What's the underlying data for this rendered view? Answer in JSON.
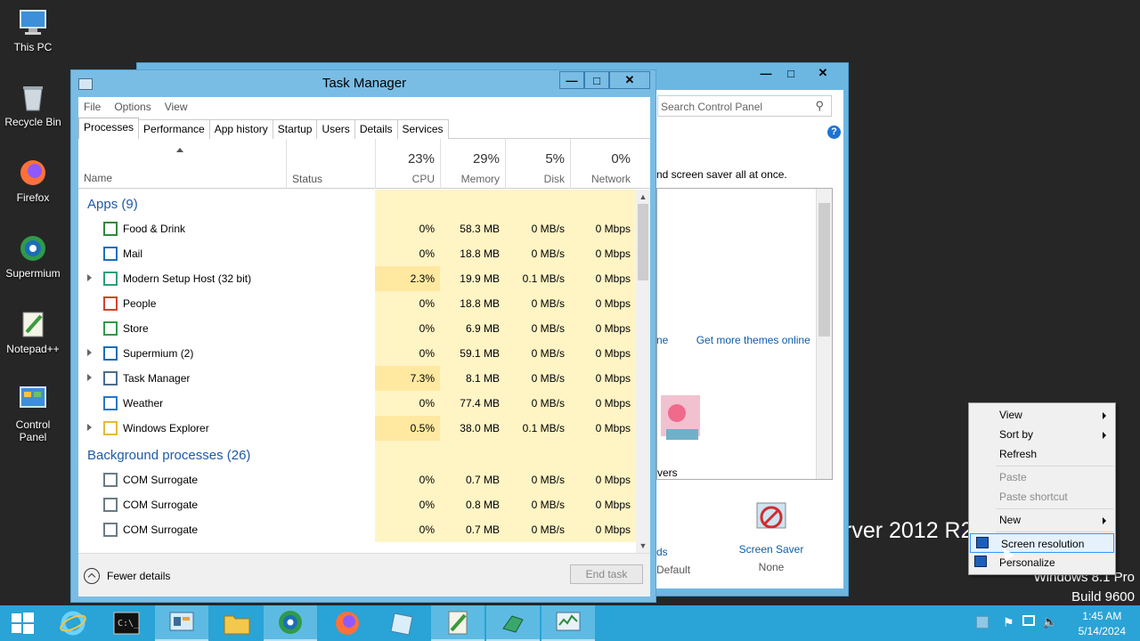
{
  "desktop": {
    "icons": [
      {
        "label": "This PC",
        "icon": "computer-icon"
      },
      {
        "label": "Recycle Bin",
        "icon": "recycle-bin-icon"
      },
      {
        "label": "Firefox",
        "icon": "firefox-icon"
      },
      {
        "label": "Supermium",
        "icon": "supermium-icon"
      },
      {
        "label": "Notepad++",
        "icon": "notepad-plus-icon"
      },
      {
        "label": "Control Panel",
        "icon": "control-panel-icon"
      }
    ],
    "watermark_line1": "rver 2012 R2",
    "watermark_line2": "Windows 8.1 Pro",
    "watermark_line3": "Build 9600"
  },
  "control_panel": {
    "search_placeholder": "Search Control Panel",
    "description": "nd screen saver all at once.",
    "themes_link_a": "ne",
    "themes_link_b": "Get more themes online",
    "vers_label": "vers",
    "screen_saver_label": "Screen Saver",
    "screen_saver_value": "None",
    "left_label": "ds",
    "left_value": "Default"
  },
  "task_manager": {
    "title": "Task Manager",
    "menu": [
      "File",
      "Options",
      "View"
    ],
    "tabs": [
      "Processes",
      "Performance",
      "App history",
      "Startup",
      "Users",
      "Details",
      "Services"
    ],
    "active_tab": "Processes",
    "columns": {
      "name": "Name",
      "status": "Status",
      "cpu": {
        "pct": "23%",
        "label": "CPU"
      },
      "memory": {
        "pct": "29%",
        "label": "Memory"
      },
      "disk": {
        "pct": "5%",
        "label": "Disk"
      },
      "network": {
        "pct": "0%",
        "label": "Network"
      }
    },
    "groups": [
      {
        "label": "Apps (9)",
        "rows": [
          {
            "name": "Food & Drink",
            "expandable": false,
            "cpu": "0%",
            "mem": "58.3 MB",
            "disk": "0 MB/s",
            "net": "0 Mbps",
            "icon": "food-drink-icon",
            "cpu_hot": false
          },
          {
            "name": "Mail",
            "expandable": false,
            "cpu": "0%",
            "mem": "18.8 MB",
            "disk": "0 MB/s",
            "net": "0 Mbps",
            "icon": "mail-icon",
            "cpu_hot": false
          },
          {
            "name": "Modern Setup Host (32 bit)",
            "expandable": true,
            "cpu": "2.3%",
            "mem": "19.9 MB",
            "disk": "0.1 MB/s",
            "net": "0 Mbps",
            "icon": "setup-host-icon",
            "cpu_hot": true
          },
          {
            "name": "People",
            "expandable": false,
            "cpu": "0%",
            "mem": "18.8 MB",
            "disk": "0 MB/s",
            "net": "0 Mbps",
            "icon": "people-icon",
            "cpu_hot": false
          },
          {
            "name": "Store",
            "expandable": false,
            "cpu": "0%",
            "mem": "6.9 MB",
            "disk": "0 MB/s",
            "net": "0 Mbps",
            "icon": "store-icon",
            "cpu_hot": false
          },
          {
            "name": "Supermium (2)",
            "expandable": true,
            "cpu": "0%",
            "mem": "59.1 MB",
            "disk": "0 MB/s",
            "net": "0 Mbps",
            "icon": "supermium-icon",
            "cpu_hot": false
          },
          {
            "name": "Task Manager",
            "expandable": true,
            "cpu": "7.3%",
            "mem": "8.1 MB",
            "disk": "0 MB/s",
            "net": "0 Mbps",
            "icon": "task-manager-icon",
            "cpu_hot": true
          },
          {
            "name": "Weather",
            "expandable": false,
            "cpu": "0%",
            "mem": "77.4 MB",
            "disk": "0 MB/s",
            "net": "0 Mbps",
            "icon": "weather-icon",
            "cpu_hot": false
          },
          {
            "name": "Windows Explorer",
            "expandable": true,
            "cpu": "0.5%",
            "mem": "38.0 MB",
            "disk": "0.1 MB/s",
            "net": "0 Mbps",
            "icon": "folder-icon",
            "cpu_hot": true
          }
        ]
      },
      {
        "label": "Background processes (26)",
        "rows": [
          {
            "name": "COM Surrogate",
            "expandable": false,
            "cpu": "0%",
            "mem": "0.7 MB",
            "disk": "0 MB/s",
            "net": "0 Mbps",
            "icon": "com-surrogate-icon",
            "cpu_hot": false
          },
          {
            "name": "COM Surrogate",
            "expandable": false,
            "cpu": "0%",
            "mem": "0.8 MB",
            "disk": "0 MB/s",
            "net": "0 Mbps",
            "icon": "com-surrogate-icon",
            "cpu_hot": false
          },
          {
            "name": "COM Surrogate",
            "expandable": false,
            "cpu": "0%",
            "mem": "0.7 MB",
            "disk": "0 MB/s",
            "net": "0 Mbps",
            "icon": "com-surrogate-icon",
            "cpu_hot": false
          }
        ]
      }
    ],
    "fewer_details": "Fewer details",
    "end_task": "End task"
  },
  "context_menu": {
    "items": [
      {
        "label": "View",
        "submenu": true,
        "disabled": false
      },
      {
        "label": "Sort by",
        "submenu": true,
        "disabled": false
      },
      {
        "label": "Refresh",
        "submenu": false,
        "disabled": false
      },
      {
        "label": "Paste",
        "submenu": false,
        "disabled": true
      },
      {
        "label": "Paste shortcut",
        "submenu": false,
        "disabled": true
      },
      {
        "label": "New",
        "submenu": true,
        "disabled": false
      },
      {
        "label": "Screen resolution",
        "submenu": false,
        "disabled": false,
        "highlighted": true
      },
      {
        "label": "Personalize",
        "submenu": false,
        "disabled": false
      }
    ]
  },
  "taskbar": {
    "buttons": [
      "start-icon",
      "internet-explorer-icon",
      "command-prompt-icon",
      "server-manager-icon",
      "file-explorer-icon",
      "supermium-icon",
      "firefox-icon",
      "notepad-icon",
      "notepad-plus-icon",
      "task-manager-icon"
    ],
    "time": "1:45 AM",
    "date": "5/14/2024"
  },
  "colors": {
    "taskbar": "#2aa3d6",
    "window_frame": "#79bde5",
    "heat_low": "#fff4c4",
    "heat_mid": "#ffe9a0",
    "group_text": "#1e5aa8"
  }
}
